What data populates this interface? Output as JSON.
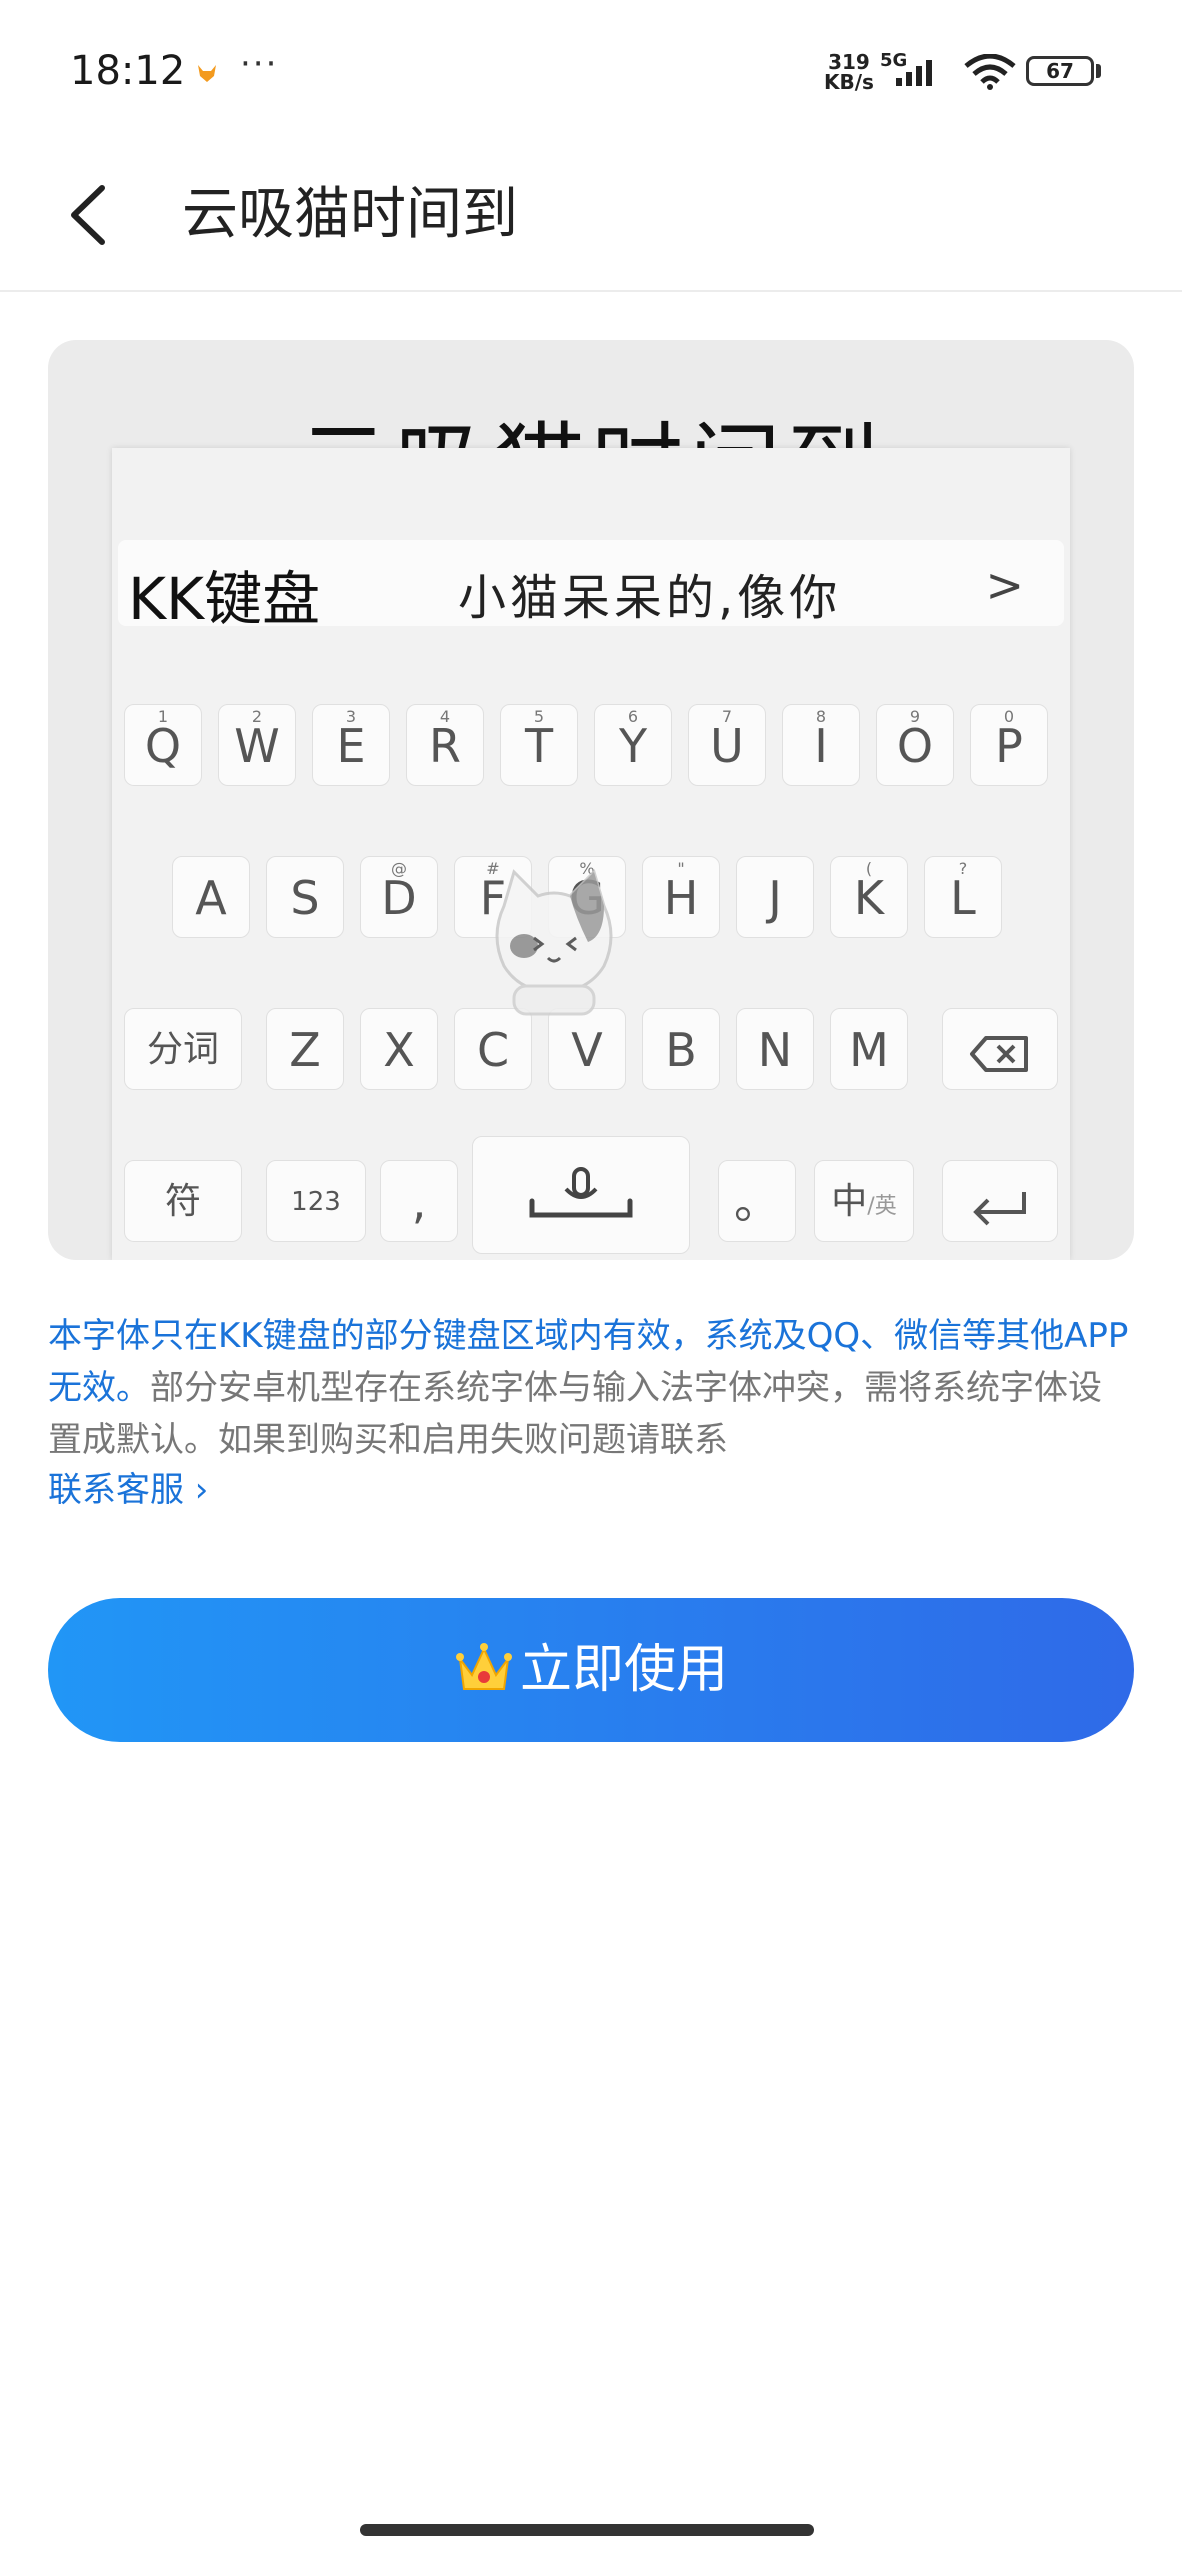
{
  "status_bar": {
    "time": "18:12",
    "more": "···",
    "net_speed_value": "319",
    "net_speed_unit": "KB/s",
    "network": "5G",
    "battery": "67"
  },
  "header": {
    "title": "云吸猫时间到"
  },
  "preview": {
    "title": "云吸猫时间到",
    "brand": "KK键盘",
    "candidate": "小猫呆呆的,像你",
    "rows": {
      "row1": [
        {
          "label": "Q",
          "hint": "1"
        },
        {
          "label": "W",
          "hint": "2"
        },
        {
          "label": "E",
          "hint": "3"
        },
        {
          "label": "R",
          "hint": "4"
        },
        {
          "label": "T",
          "hint": "5"
        },
        {
          "label": "Y",
          "hint": "6"
        },
        {
          "label": "U",
          "hint": "7"
        },
        {
          "label": "I",
          "hint": "8"
        },
        {
          "label": "O",
          "hint": "9"
        },
        {
          "label": "P",
          "hint": "0"
        }
      ],
      "row2": [
        {
          "label": "A",
          "hint": ""
        },
        {
          "label": "S",
          "hint": ""
        },
        {
          "label": "D",
          "hint": "@"
        },
        {
          "label": "F",
          "hint": "#"
        },
        {
          "label": "G",
          "hint": "%"
        },
        {
          "label": "H",
          "hint": "\""
        },
        {
          "label": "J",
          "hint": ""
        },
        {
          "label": "K",
          "hint": "("
        },
        {
          "label": "L",
          "hint": "?"
        }
      ],
      "row3": [
        {
          "label": "分词",
          "hint": ""
        },
        {
          "label": "Z",
          "hint": ""
        },
        {
          "label": "X",
          "hint": ""
        },
        {
          "label": "C",
          "hint": ""
        },
        {
          "label": "V",
          "hint": ""
        },
        {
          "label": "B",
          "hint": ""
        },
        {
          "label": "N",
          "hint": ""
        },
        {
          "label": "M",
          "hint": ""
        }
      ],
      "row4": {
        "symbols": "符",
        "numbers": "123",
        "comma": ",",
        "period": "。",
        "lang": "中",
        "lang_alt": "/英"
      }
    }
  },
  "description": {
    "highlight": "本字体只在KK键盘的部分键盘区域内有效，系统及QQ、微信等其他APP无效。",
    "normal": "部分安卓机型存在系统字体与输入法字体冲突，需将系统字体设置成默认。如果到购买和启用失败问题请联系",
    "contact_link": "联系客服 ›"
  },
  "action": {
    "use_button": "立即使用"
  },
  "colors": {
    "accent": "#1a73d9",
    "button_start": "#2196f6",
    "button_end": "#2f6ae8"
  }
}
